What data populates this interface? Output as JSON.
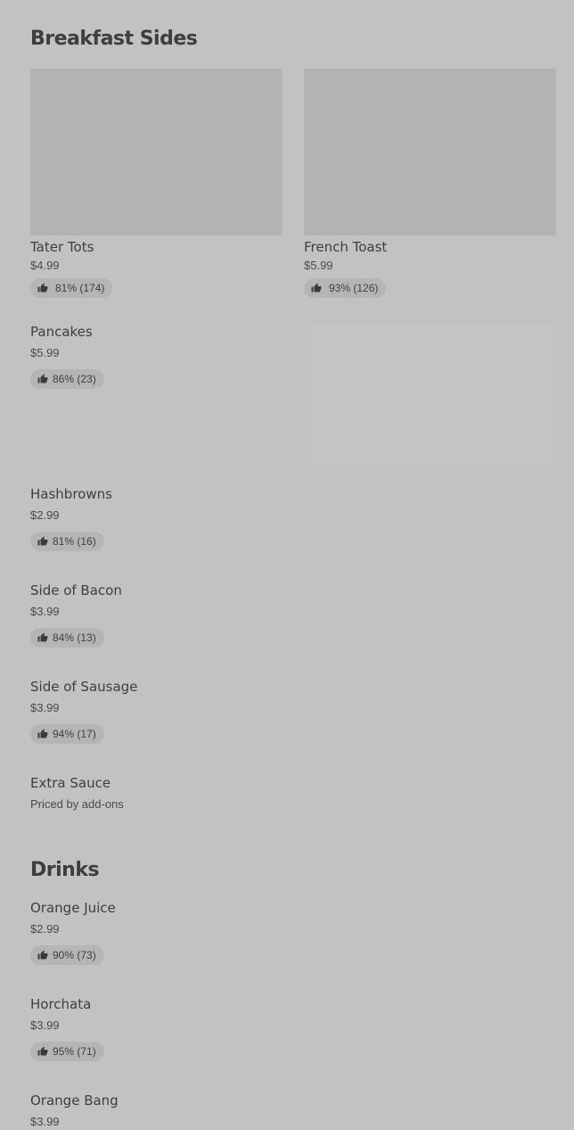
{
  "sections": {
    "breakfast_sides": {
      "title": "Breakfast Sides",
      "featured": [
        {
          "name": "Tater Tots",
          "price": "$4.99",
          "rating": "81% (174)"
        },
        {
          "name": "French Toast",
          "price": "$5.99",
          "rating": "93% (126)"
        }
      ],
      "items": [
        {
          "name": "Pancakes",
          "price": "$5.99",
          "rating": "86% (23)"
        },
        {
          "name": "Hashbrowns",
          "price": "$2.99",
          "rating": "81% (16)"
        },
        {
          "name": "Side of Bacon",
          "price": "$3.99",
          "rating": "84% (13)"
        },
        {
          "name": "Side of Sausage",
          "price": "$3.99",
          "rating": "94% (17)"
        },
        {
          "name": "Extra Sauce",
          "price": "Priced by add-ons"
        }
      ]
    },
    "drinks": {
      "title": "Drinks",
      "items": [
        {
          "name": "Orange Juice",
          "price": "$2.99",
          "rating": "90% (73)"
        },
        {
          "name": "Horchata",
          "price": "$3.99",
          "rating": "95% (71)"
        },
        {
          "name": "Orange Bang",
          "price": "$3.99"
        }
      ]
    }
  },
  "icons": {
    "rating": "thumbs-up-icon"
  },
  "colors": {
    "page_background": "#c2c2c2",
    "image_placeholder": "#b3b3b3",
    "rating_pill": "#b5b5b5",
    "text": "#3e3e3e"
  }
}
